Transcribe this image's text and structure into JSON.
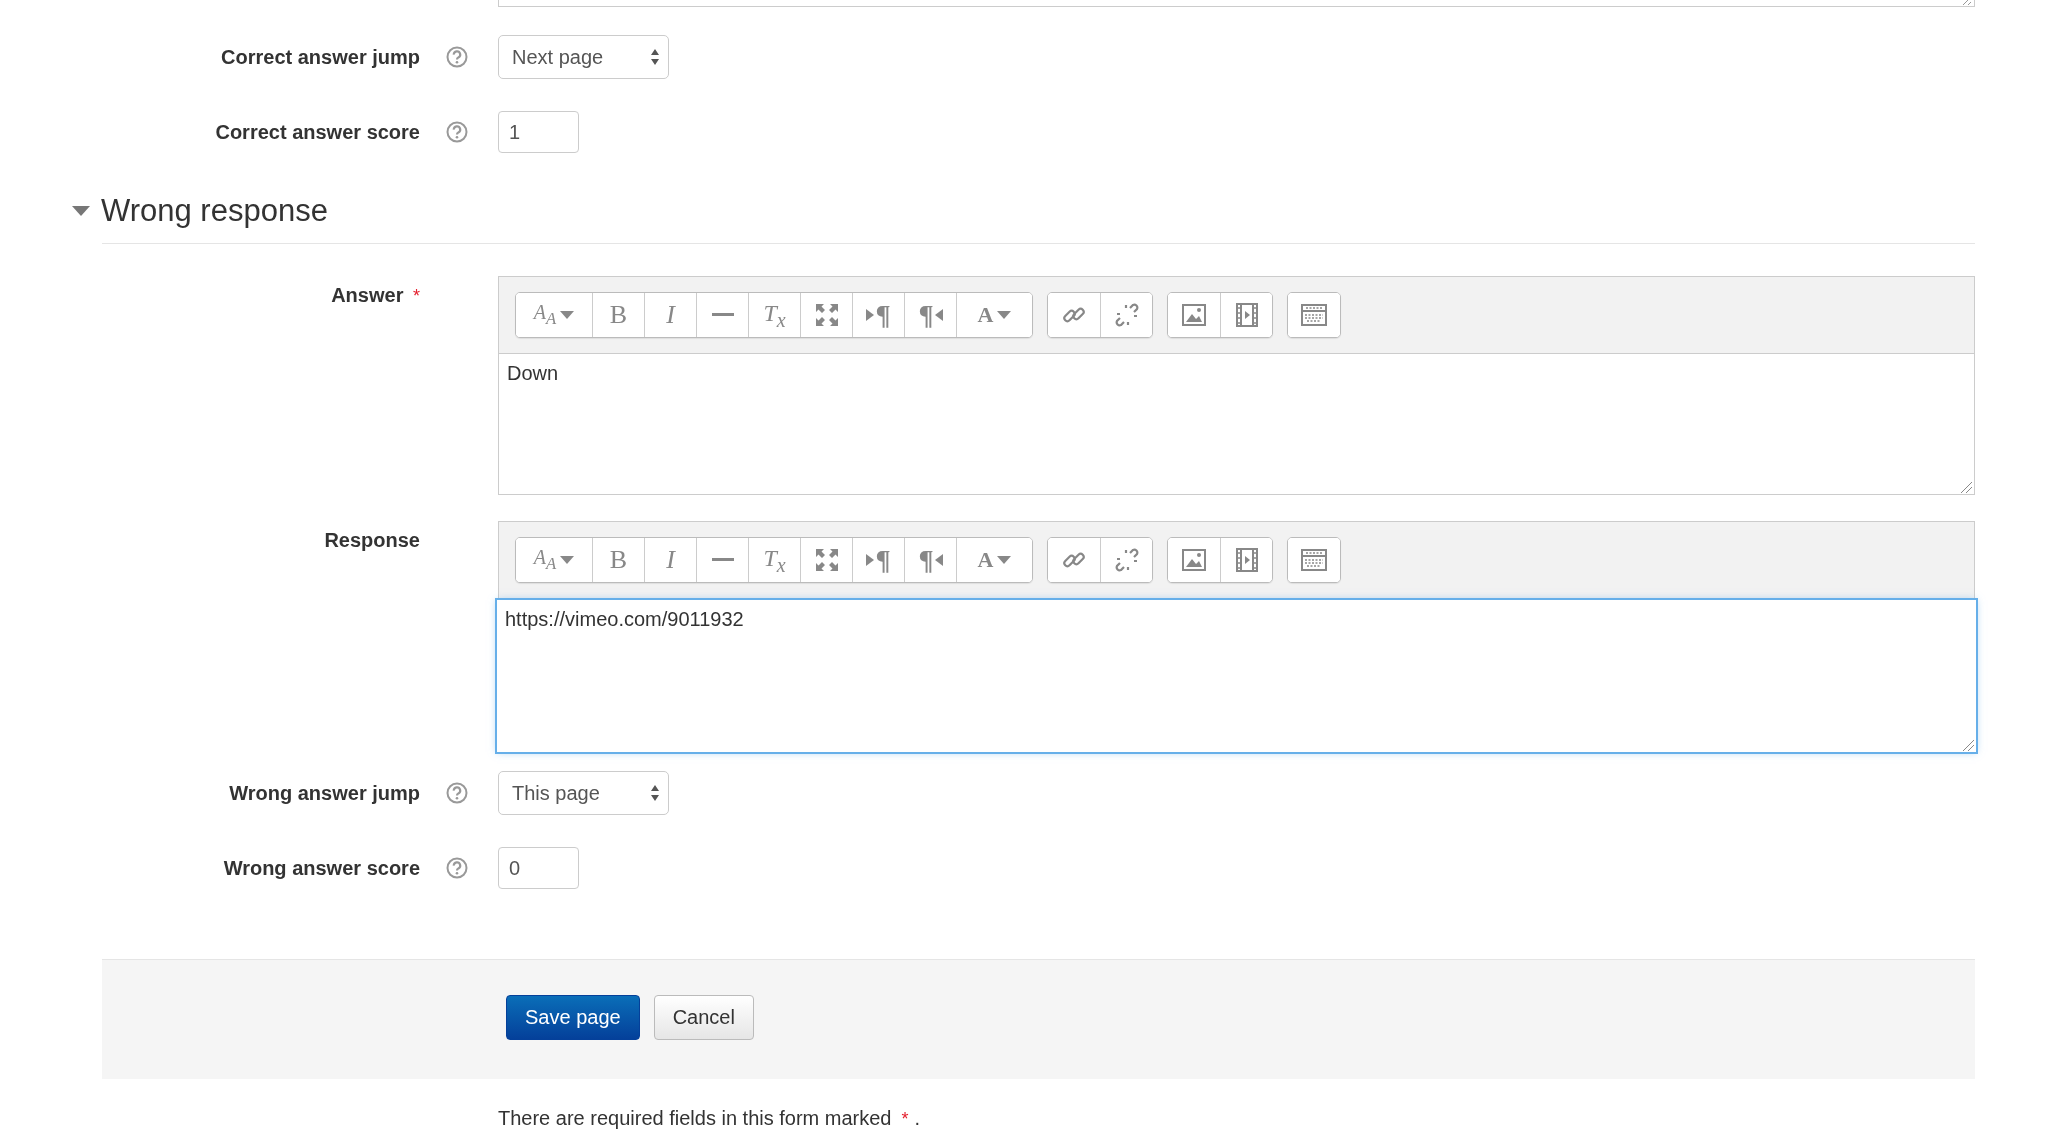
{
  "correct_fields": [
    {
      "label": "Correct answer jump",
      "kind": "select",
      "value": "Next page",
      "help": true
    },
    {
      "label": "Correct answer score",
      "kind": "text",
      "value": "1",
      "help": true
    }
  ],
  "section": {
    "title": "Wrong response",
    "expanded": true
  },
  "editors": [
    {
      "label": "Answer",
      "required_mark": "*",
      "content": "Down",
      "focused": false,
      "toolbar": [
        [
          {
            "kind": "styles",
            "glyph": "A$_{A}$",
            "dropdown": true
          },
          {
            "kind": "bold",
            "glyph": "B"
          },
          {
            "kind": "italic",
            "glyph": "I"
          },
          {
            "kind": "rule"
          },
          {
            "kind": "clear",
            "glyph": "T$_{x}$"
          },
          {
            "kind": "fullscreen"
          },
          {
            "kind": "ltr",
            "glyph": "¶"
          },
          {
            "kind": "rtl",
            "glyph": "¶"
          },
          {
            "kind": "color",
            "glyph": "A",
            "dropdown": true
          }
        ],
        [
          {
            "kind": "link"
          },
          {
            "kind": "unlink"
          }
        ],
        [
          {
            "kind": "image"
          },
          {
            "kind": "media"
          }
        ],
        [
          {
            "kind": "table"
          }
        ]
      ]
    },
    {
      "label": "Response",
      "content": "https://vimeo.com/9011932",
      "focused": true,
      "toolbar": [
        [
          {
            "kind": "styles",
            "glyph": "A$_{A}$",
            "dropdown": true
          },
          {
            "kind": "bold",
            "glyph": "B"
          },
          {
            "kind": "italic",
            "glyph": "I"
          },
          {
            "kind": "rule"
          },
          {
            "kind": "clear",
            "glyph": "T$_{x}$"
          },
          {
            "kind": "fullscreen"
          },
          {
            "kind": "ltr",
            "glyph": "¶"
          },
          {
            "kind": "rtl",
            "glyph": "¶"
          },
          {
            "kind": "color",
            "glyph": "A",
            "dropdown": true
          }
        ],
        [
          {
            "kind": "link"
          },
          {
            "kind": "unlink"
          }
        ],
        [
          {
            "kind": "image"
          },
          {
            "kind": "media"
          }
        ],
        [
          {
            "kind": "table"
          }
        ]
      ]
    }
  ],
  "wrong_fields": [
    {
      "label": "Wrong answer jump",
      "kind": "select",
      "value": "This page",
      "help": true
    },
    {
      "label": "Wrong answer score",
      "kind": "text",
      "value": "0",
      "help": true
    }
  ],
  "buttons": [
    {
      "label": "Save page",
      "kind": "primary"
    },
    {
      "label": "Cancel",
      "kind": "default"
    }
  ],
  "note": {
    "text": "There are required fields in this form marked",
    "mark": "*",
    "end": "."
  }
}
